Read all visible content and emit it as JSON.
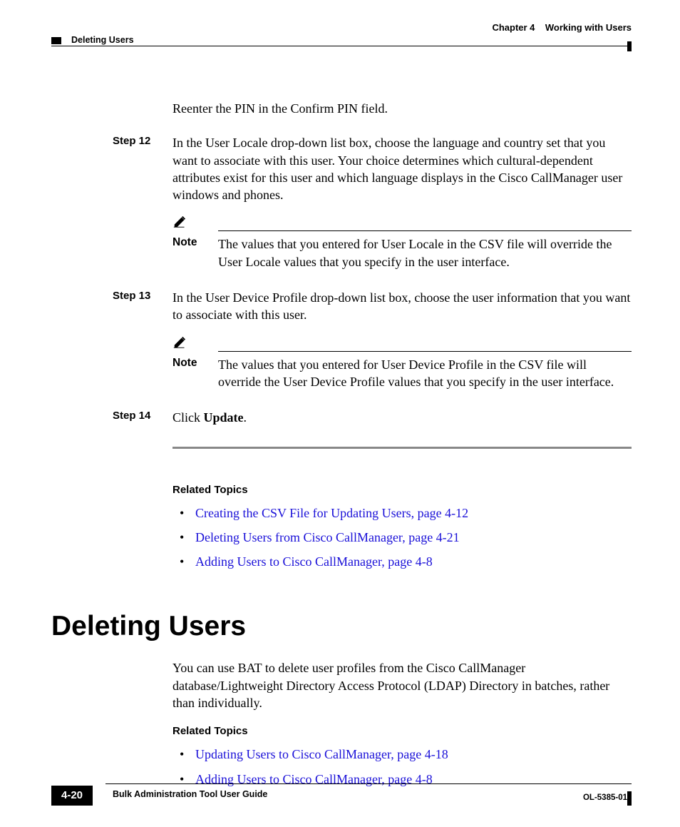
{
  "header": {
    "chapter_label": "Chapter 4",
    "chapter_title": "Working with Users",
    "section": "Deleting Users"
  },
  "body": {
    "intro": "Reenter the PIN in the Confirm PIN field.",
    "steps": [
      {
        "num": "Step 12",
        "text": "In the User Locale drop-down list box, choose the language and country set that you want to associate with this user. Your choice determines which cultural-dependent attributes exist for this user and which language displays in the Cisco CallManager user windows and phones.",
        "note_label": "Note",
        "note_text": "The values that you entered for User Locale in the CSV file will override the User Locale values that you specify in the user interface."
      },
      {
        "num": "Step 13",
        "text": "In the User Device Profile drop-down list box, choose the user information that you want to associate with this user.",
        "note_label": "Note",
        "note_text": "The values that you entered for User Device Profile in the CSV file will override the User Device Profile values that you specify in the user interface."
      },
      {
        "num": "Step 14",
        "text_prefix": "Click ",
        "text_bold": "Update",
        "text_suffix": "."
      }
    ],
    "related1": {
      "heading": "Related Topics",
      "items": [
        "Creating the CSV File for Updating Users, page 4-12",
        "Deleting Users from Cisco CallManager, page 4-21",
        "Adding Users to Cisco CallManager, page 4-8"
      ]
    },
    "section_heading": "Deleting Users",
    "section_para": "You can use BAT to delete user profiles from the Cisco CallManager database/Lightweight Directory Access Protocol (LDAP) Directory in batches, rather than individually.",
    "related2": {
      "heading": "Related Topics",
      "items": [
        "Updating Users to Cisco CallManager, page 4-18",
        "Adding Users to Cisco CallManager, page 4-8"
      ]
    }
  },
  "footer": {
    "book_title": "Bulk Administration Tool User Guide",
    "page_num": "4-20",
    "doc_code": "OL-5385-01"
  }
}
